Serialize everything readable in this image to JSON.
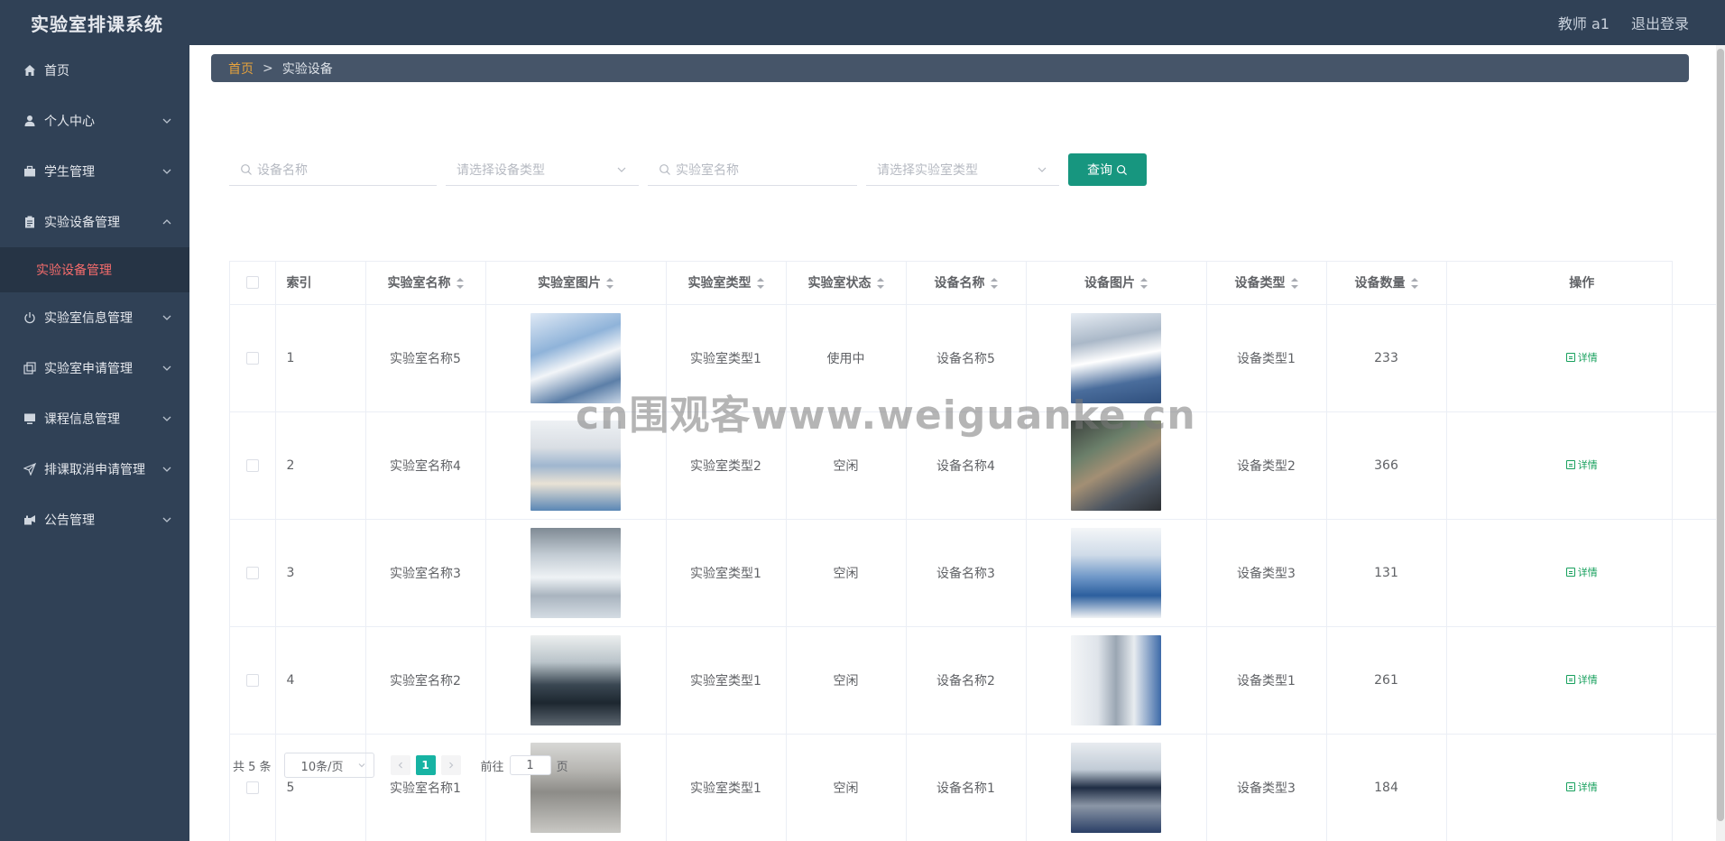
{
  "app": {
    "title": "实验室排课系统"
  },
  "header": {
    "user": "教师 a1",
    "logout": "退出登录"
  },
  "sidebar": {
    "items": [
      {
        "label": "首页",
        "icon": "home-icon"
      },
      {
        "label": "个人中心",
        "icon": "user-icon"
      },
      {
        "label": "学生管理",
        "icon": "briefcase-icon"
      },
      {
        "label": "实验设备管理",
        "icon": "clipboard-icon",
        "expanded": true
      },
      {
        "label": "实验室信息管理",
        "icon": "power-icon"
      },
      {
        "label": "实验室申请管理",
        "icon": "copy-icon"
      },
      {
        "label": "课程信息管理",
        "icon": "monitor-icon"
      },
      {
        "label": "排课取消申请管理",
        "icon": "send-icon"
      },
      {
        "label": "公告管理",
        "icon": "megaphone-icon"
      }
    ],
    "sub_item": "实验设备管理"
  },
  "breadcrumb": {
    "home": "首页",
    "separator": ">",
    "current": "实验设备"
  },
  "search": {
    "device_name_placeholder": "设备名称",
    "device_type_placeholder": "请选择设备类型",
    "lab_name_placeholder": "实验室名称",
    "lab_type_placeholder": "请选择实验室类型",
    "query_label": "查询"
  },
  "table": {
    "headers": [
      "索引",
      "实验室名称",
      "实验室图片",
      "实验室类型",
      "实验室状态",
      "设备名称",
      "设备图片",
      "设备类型",
      "设备数量",
      "操作"
    ],
    "rows": [
      {
        "index": "1",
        "lab_name": "实验室名称5",
        "lab_type": "实验室类型1",
        "lab_status": "使用中",
        "device_name": "设备名称5",
        "device_type": "设备类型1",
        "count": "233"
      },
      {
        "index": "2",
        "lab_name": "实验室名称4",
        "lab_type": "实验室类型2",
        "lab_status": "空闲",
        "device_name": "设备名称4",
        "device_type": "设备类型2",
        "count": "366"
      },
      {
        "index": "3",
        "lab_name": "实验室名称3",
        "lab_type": "实验室类型1",
        "lab_status": "空闲",
        "device_name": "设备名称3",
        "device_type": "设备类型3",
        "count": "131"
      },
      {
        "index": "4",
        "lab_name": "实验室名称2",
        "lab_type": "实验室类型1",
        "lab_status": "空闲",
        "device_name": "设备名称2",
        "device_type": "设备类型1",
        "count": "261"
      },
      {
        "index": "5",
        "lab_name": "实验室名称1",
        "lab_type": "实验室类型1",
        "lab_status": "空闲",
        "device_name": "设备名称1",
        "device_type": "设备类型3",
        "count": "184"
      }
    ],
    "detail_label": "详情"
  },
  "pagination": {
    "total": "共 5 条",
    "page_size": "10条/页",
    "current_page": "1",
    "goto_prefix": "前往",
    "goto_value": "1",
    "goto_suffix": "页"
  },
  "watermark": "cn围观客www.weiguanke.cn",
  "colors": {
    "header_bg": "#304156",
    "accent_green": "#17967f",
    "active_red": "#f56c6c",
    "breadcrumb_home": "#e6a23c"
  }
}
